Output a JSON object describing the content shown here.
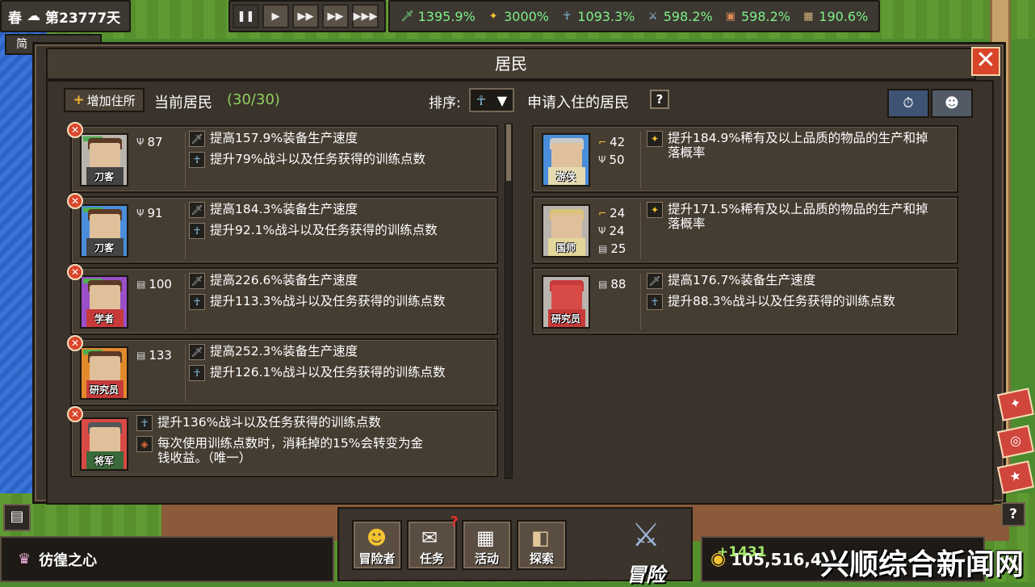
{
  "hud": {
    "season": "春",
    "weather_icon": "cloud-icon",
    "day": "第23777天",
    "speed_buttons": [
      "pause",
      "play",
      "fast",
      "faster",
      "fastest"
    ],
    "stats": [
      {
        "icon": "sword-icon",
        "value": "1395.9%"
      },
      {
        "icon": "lamp-icon",
        "value": "3000%"
      },
      {
        "icon": "training-icon",
        "value": "1093.3%"
      },
      {
        "icon": "blade-icon",
        "value": "598.2%"
      },
      {
        "icon": "chest-icon",
        "value": "598.2%"
      },
      {
        "icon": "crate-icon",
        "value": "190.6%"
      }
    ],
    "small_tab": "简"
  },
  "modal": {
    "title": "居民",
    "close": "✕",
    "add_button": "增加住所",
    "current_title": "当前居民",
    "current_count": "(30/30)",
    "sort_label": "排序:",
    "apply_title": "申请入住的居民",
    "help": "?"
  },
  "current_residents": [
    {
      "role": "刀客",
      "color": "grey",
      "attrs": [
        {
          "icon": "antler-icon",
          "value": "87"
        }
      ],
      "effects": [
        {
          "icon": "sword-icon",
          "text": "提高157.9%装备生产速度"
        },
        {
          "icon": "training-icon",
          "text": "提升79%战斗以及任务获得的训练点数"
        }
      ]
    },
    {
      "role": "刀客",
      "color": "blue",
      "attrs": [
        {
          "icon": "antler-icon",
          "value": "91"
        }
      ],
      "effects": [
        {
          "icon": "sword-icon",
          "text": "提高184.3%装备生产速度"
        },
        {
          "icon": "training-icon",
          "text": "提升92.1%战斗以及任务获得的训练点数"
        }
      ]
    },
    {
      "role": "学者",
      "color": "purple",
      "attrs": [
        {
          "icon": "scroll-icon",
          "value": "100"
        }
      ],
      "effects": [
        {
          "icon": "sword-icon",
          "text": "提高226.6%装备生产速度"
        },
        {
          "icon": "training-icon",
          "text": "提升113.3%战斗以及任务获得的训练点数"
        }
      ]
    },
    {
      "role": "研究员",
      "color": "orange",
      "attrs": [
        {
          "icon": "scroll-icon",
          "value": "133"
        }
      ],
      "effects": [
        {
          "icon": "sword-icon",
          "text": "提高252.3%装备生产速度"
        },
        {
          "icon": "training-icon",
          "text": "提升126.1%战斗以及任务获得的训练点数"
        }
      ]
    },
    {
      "role": "将军",
      "color": "red",
      "attrs": [],
      "effects": [
        {
          "icon": "training-icon",
          "text": "提升136%战斗以及任务获得的训练点数"
        },
        {
          "icon": "coin-convert-icon",
          "text": "每次使用训练点数时，消耗掉的15%会转变为金钱收益。（唯一）"
        }
      ]
    }
  ],
  "applicants": [
    {
      "role": "游侠",
      "color": "blue",
      "attrs": [
        {
          "icon": "boot-icon",
          "value": "42"
        },
        {
          "icon": "antler-icon",
          "value": "50"
        }
      ],
      "effects": [
        {
          "icon": "lamp-icon",
          "text": "提升184.9%稀有及以上品质的物品的生产和掉落概率"
        }
      ]
    },
    {
      "role": "国师",
      "color": "grey",
      "attrs": [
        {
          "icon": "boot-icon",
          "value": "24"
        },
        {
          "icon": "antler-icon",
          "value": "24"
        },
        {
          "icon": "scroll-icon",
          "value": "25"
        }
      ],
      "effects": [
        {
          "icon": "lamp-icon",
          "text": "提升171.5%稀有及以上品质的物品的生产和掉落概率"
        }
      ]
    },
    {
      "role": "研究员",
      "color": "grey",
      "attrs": [
        {
          "icon": "scroll-icon",
          "value": "88"
        }
      ],
      "effects": [
        {
          "icon": "sword-icon",
          "text": "提高176.7%装备生产速度"
        },
        {
          "icon": "training-icon",
          "text": "提升88.3%战斗以及任务获得的训练点数"
        }
      ]
    }
  ],
  "bottom": {
    "title": "彷徨之心",
    "nav": [
      {
        "label": "冒险者",
        "icon": "adventurer-icon"
      },
      {
        "label": "任务",
        "icon": "task-icon"
      },
      {
        "label": "活动",
        "icon": "activity-icon"
      },
      {
        "label": "探索",
        "icon": "explore-icon"
      }
    ],
    "adventure_label": "冒险",
    "money": "105,516,4",
    "gain": "+1431",
    "watermark": "兴顺综合新闻网",
    "help": "?"
  }
}
